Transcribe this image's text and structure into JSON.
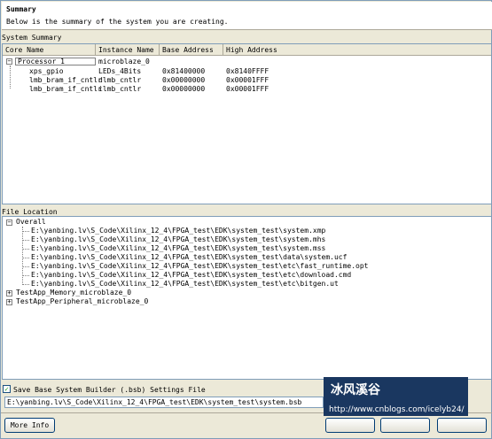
{
  "header": {
    "title": "Summary",
    "description": "Below is the summary of the system you are creating."
  },
  "system_summary": {
    "label": "System Summary",
    "columns": [
      "Core Name",
      "Instance Name",
      "Base Address",
      "High Address"
    ],
    "processor": {
      "name": "Processor 1",
      "instance": "microblaze_0"
    },
    "rows": [
      {
        "core": "xps_gpio",
        "instance": "LEDs_4Bits",
        "base": "0x81400000",
        "high": "0x8140FFFF"
      },
      {
        "core": "lmb_bram_if_cntlr",
        "instance": "dlmb_cntlr",
        "base": "0x00000000",
        "high": "0x00001FFF"
      },
      {
        "core": "lmb_bram_if_cntlr",
        "instance": "ilmb_cntlr",
        "base": "0x00000000",
        "high": "0x00001FFF"
      }
    ]
  },
  "file_location": {
    "label": "File Location",
    "overall_label": "Overall",
    "files": [
      "E:\\yanbing.lv\\S_Code\\Xilinx_12_4\\FPGA_test\\EDK\\system_test\\system.xmp",
      "E:\\yanbing.lv\\S_Code\\Xilinx_12_4\\FPGA_test\\EDK\\system_test\\system.mhs",
      "E:\\yanbing.lv\\S_Code\\Xilinx_12_4\\FPGA_test\\EDK\\system_test\\system.mss",
      "E:\\yanbing.lv\\S_Code\\Xilinx_12_4\\FPGA_test\\EDK\\system_test\\data\\system.ucf",
      "E:\\yanbing.lv\\S_Code\\Xilinx_12_4\\FPGA_test\\EDK\\system_test\\etc\\fast_runtime.opt",
      "E:\\yanbing.lv\\S_Code\\Xilinx_12_4\\FPGA_test\\EDK\\system_test\\etc\\download.cmd",
      "E:\\yanbing.lv\\S_Code\\Xilinx_12_4\\FPGA_test\\EDK\\system_test\\etc\\bitgen.ut"
    ],
    "test_apps": [
      "TestApp_Memory_microblaze_0",
      "TestApp_Peripheral_microblaze_0"
    ]
  },
  "save_settings": {
    "checkbox_label": "Save Base System Builder (.bsb) Settings File",
    "checked": true,
    "path": "E:\\yanbing.lv\\S_Code\\Xilinx_12_4\\FPGA_test\\EDK\\system_test\\system.bsb"
  },
  "buttons": {
    "more_info": "More Info"
  },
  "watermark": {
    "title": "冰风溪谷",
    "url": "http://www.cnblogs.com/icelyb24/"
  }
}
